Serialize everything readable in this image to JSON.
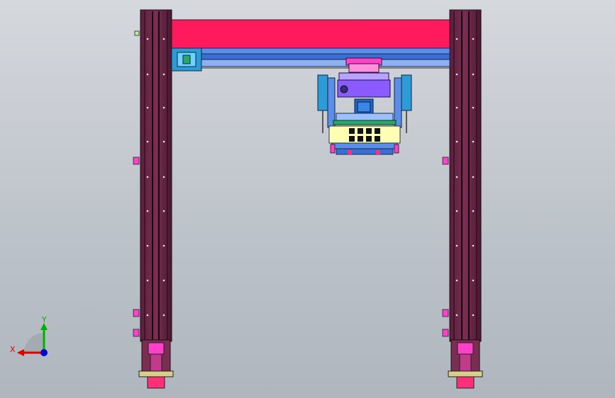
{
  "viewport": {
    "title": "",
    "background_top": "#d5d8dd",
    "background_bottom": "#b0b6be"
  },
  "model": {
    "name": "",
    "colors": {
      "column": "#6e2a4a",
      "column_dark": "#3a1428",
      "beam": "#ff1a5e",
      "rail": "#3a6fd1",
      "carriage": "#8a5cff",
      "head_panel": "#ffffb4",
      "magenta_block": "#ff40c8",
      "sensor": "#2d9bd6"
    }
  },
  "triad": {
    "x_label": "X",
    "y_label": "Y",
    "x_color": "#e00000",
    "y_color": "#00b000",
    "z_color": "#0000d0"
  }
}
